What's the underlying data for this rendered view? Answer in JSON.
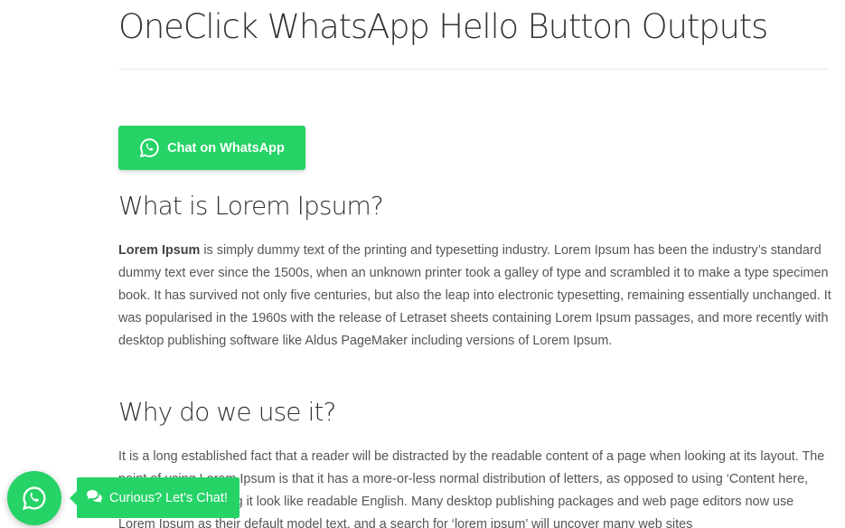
{
  "page": {
    "title": "OneClick WhatsApp Hello Button Outputs"
  },
  "whatsapp_button": {
    "label": "Chat on WhatsApp",
    "icon": "whatsapp-icon",
    "color": "#25d366"
  },
  "sections": [
    {
      "heading": "What is Lorem Ipsum?",
      "bold_lead": "Lorem Ipsum",
      "text": " is simply dummy text of the printing and typesetting industry. Lorem Ipsum has been the industry’s standard dummy text ever since the 1500s, when an unknown printer took a galley of type and scrambled it to make a type specimen book. It has survived not only five centuries, but also the leap into electronic typesetting, remaining essentially unchanged. It was popularised in the 1960s with the release of Letraset sheets containing Lorem Ipsum passages, and more recently with desktop publishing software like Aldus PageMaker including versions of Lorem Ipsum."
    },
    {
      "heading": "Why do we use it?",
      "text": "It is a long established fact that a reader will be distracted by the readable content of a page when looking at its layout. The point of using Lorem Ipsum is that it has a more-or-less normal distribution of letters, as opposed to using ‘Content here, content here’, making it look like readable English. Many desktop publishing packages and web page editors now use Lorem Ipsum as their default model text, and a search for ‘lorem ipsum’ will uncover many web sites"
    }
  ],
  "floating_chat": {
    "circle_icon": "whatsapp-icon",
    "bubble_icon": "chat-bubbles-icon",
    "bubble_label": "Curious? Let's Chat!",
    "color": "#25d366"
  }
}
